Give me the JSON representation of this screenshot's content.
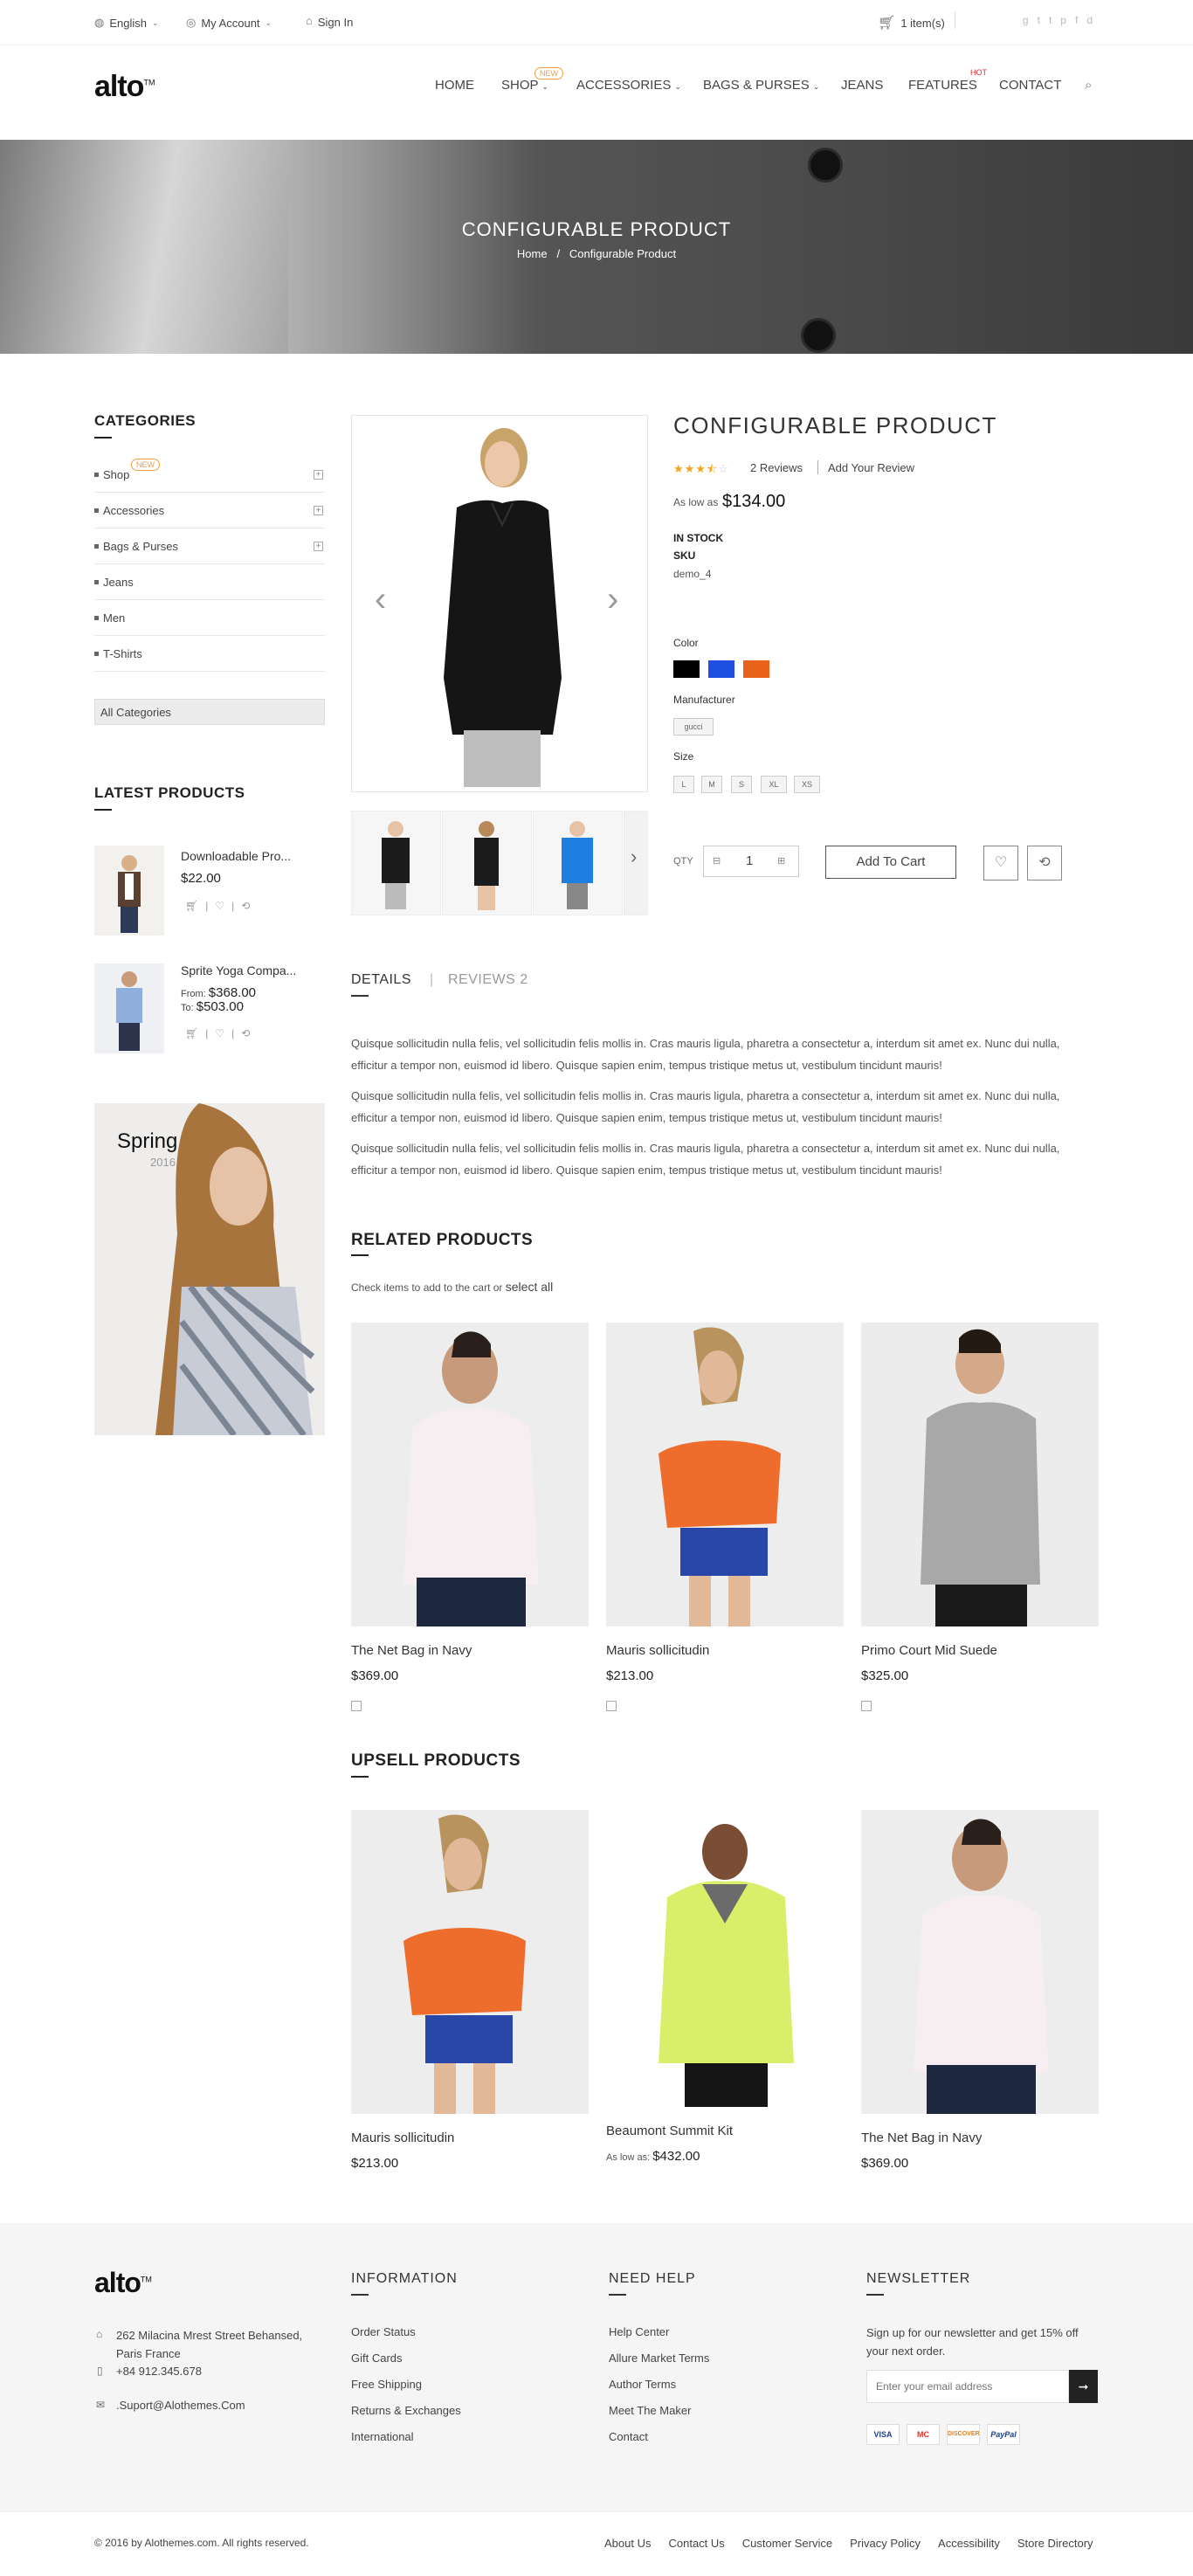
{
  "topbar": {
    "language": "English",
    "account": "My Account",
    "signin": "Sign In",
    "cart": "1 item(s)",
    "social": [
      "g",
      "t",
      "t",
      "p",
      "f",
      "d"
    ]
  },
  "header": {
    "logo": "alto",
    "logo_tm": "TM",
    "nav": [
      {
        "label": "HOME"
      },
      {
        "label": "SHOP",
        "badge": "NEW"
      },
      {
        "label": "ACCESSORIES"
      },
      {
        "label": "BAGS & PURSES"
      },
      {
        "label": "JEANS"
      },
      {
        "label": "FEATURES",
        "badge": "HOT"
      },
      {
        "label": "CONTACT"
      }
    ]
  },
  "hero": {
    "title": "CONFIGURABLE PRODUCT",
    "breadcrumb_home": "Home",
    "breadcrumb_sep": "/",
    "breadcrumb_current": "Configurable Product"
  },
  "sidebar": {
    "categories_title": "CATEGORIES",
    "categories": [
      {
        "label": "Shop",
        "badge": "NEW"
      },
      {
        "label": "Accessories"
      },
      {
        "label": "Bags & Purses"
      },
      {
        "label": "Jeans"
      },
      {
        "label": "Men"
      },
      {
        "label": "T-Shirts"
      }
    ],
    "all_categories": "All Categories",
    "latest_title": "LATEST PRODUCTS",
    "latest": [
      {
        "name": "Downloadable Pro...",
        "price": "$22.00"
      },
      {
        "name": "Sprite Yoga Compa...",
        "from_label": "From:",
        "from": "$368.00",
        "to_label": "To:",
        "to": "$503.00"
      }
    ],
    "banner_title": "Spring",
    "banner_year": "2016"
  },
  "product": {
    "title": "CONFIGURABLE PRODUCT",
    "rating": 3.5,
    "reviews": "2 Reviews",
    "add_review": "Add Your Review",
    "price_label": "As low as",
    "price": "$134.00",
    "stock": "IN STOCK",
    "sku_label": "SKU",
    "sku": "demo_4",
    "color_label": "Color",
    "colors": [
      "#000000",
      "#1f4fe0",
      "#e8621a"
    ],
    "manufacturer_label": "Manufacturer",
    "manufacturer": "gucci",
    "size_label": "Size",
    "sizes": [
      "L",
      "M",
      "S",
      "XL",
      "XS"
    ],
    "qty_label": "QTY",
    "qty": "1",
    "add_to_cart": "Add To Cart"
  },
  "tabs": {
    "details": "DETAILS",
    "sep": "|",
    "reviews": "REVIEWS 2"
  },
  "description": [
    "Quisque sollicitudin nulla felis, vel sollicitudin felis mollis in. Cras mauris ligula, pharetra a consectetur a, interdum sit amet ex. Nunc dui nulla, efficitur a tempor non, euismod id libero. Quisque sapien enim, tempus tristique metus ut, vestibulum tincidunt mauris!",
    "Quisque sollicitudin nulla felis, vel sollicitudin felis mollis in. Cras mauris ligula, pharetra a consectetur a, interdum sit amet ex. Nunc dui nulla, efficitur a tempor non, euismod id libero. Quisque sapien enim, tempus tristique metus ut, vestibulum tincidunt mauris!",
    "Quisque sollicitudin nulla felis, vel sollicitudin felis mollis in. Cras mauris ligula, pharetra a consectetur a, interdum sit amet ex. Nunc dui nulla, efficitur a tempor non, euismod id libero. Quisque sapien enim, tempus tristique metus ut, vestibulum tincidunt mauris!"
  ],
  "related": {
    "title": "RELATED PRODUCTS",
    "hint": "Check items to add to the cart or",
    "select_all": "select all",
    "items": [
      {
        "name": "The Net Bag in Navy",
        "price": "$369.00"
      },
      {
        "name": "Mauris sollicitudin",
        "price": "$213.00"
      },
      {
        "name": "Primo Court Mid Suede",
        "price": "$325.00"
      }
    ]
  },
  "upsell": {
    "title": "UPSELL PRODUCTS",
    "items": [
      {
        "name": "Mauris sollicitudin",
        "price": "$213.00"
      },
      {
        "name": "Beaumont Summit Kit",
        "price_label": "As low as:",
        "price": "$432.00"
      },
      {
        "name": "The Net Bag in Navy",
        "price": "$369.00"
      }
    ]
  },
  "footer": {
    "address": "262 Milacina Mrest Street Behansed, Paris France",
    "phone": "+84 912.345.678",
    "email": ".Suport@Alothemes.Com",
    "information_title": "INFORMATION",
    "information": [
      "Order Status",
      "Gift Cards",
      "Free Shipping",
      "Returns & Exchanges",
      "International"
    ],
    "help_title": "NEED HELP",
    "help": [
      "Help Center",
      "Allure Market Terms",
      "Author Terms",
      "Meet The Maker",
      "Contact"
    ],
    "newsletter_title": "NEWSLETTER",
    "newsletter_text": "Sign up for our newsletter and get 15% off your next order.",
    "newsletter_placeholder": "Enter your email address",
    "cards": [
      "VISA",
      "MC",
      "DISCOVER",
      "PayPal"
    ],
    "copyright": "© 2016 by Alothemes.com. All rights reserved.",
    "bottom_links": [
      "About Us",
      "Contact Us",
      "Customer Service",
      "Privacy Policy",
      "Accessibility",
      "Store Directory"
    ]
  }
}
